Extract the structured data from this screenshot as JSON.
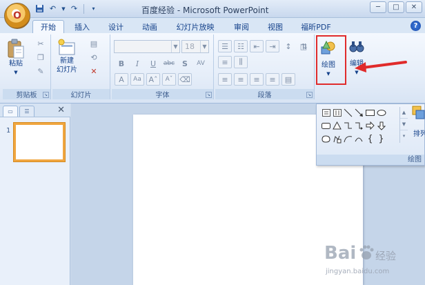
{
  "window": {
    "title": "百度经验 - Microsoft PowerPoint",
    "office_button_glyph": "O"
  },
  "quick_access": [
    "save-icon",
    "undo-icon",
    "redo-icon",
    "customize-icon"
  ],
  "window_buttons": {
    "minimize": "─",
    "restore": "□",
    "close": "✕"
  },
  "tabs": [
    {
      "label": "开始",
      "active": true
    },
    {
      "label": "插入"
    },
    {
      "label": "设计"
    },
    {
      "label": "动画"
    },
    {
      "label": "幻灯片放映"
    },
    {
      "label": "审阅"
    },
    {
      "label": "视图"
    },
    {
      "label": "福昕PDF"
    }
  ],
  "help_glyph": "?",
  "ribbon": {
    "clipboard": {
      "label": "剪贴板",
      "paste": "粘贴"
    },
    "slides": {
      "label": "幻灯片",
      "new_slide_line1": "新建",
      "new_slide_line2": "幻灯片"
    },
    "font": {
      "label": "字体",
      "font_name": "",
      "font_size": "18"
    },
    "paragraph": {
      "label": "段落"
    },
    "drawing": {
      "label": "绘图"
    },
    "editing": {
      "label": "编辑"
    }
  },
  "gallery": {
    "label": "绘图",
    "arrange": "排列"
  },
  "panel": {
    "slide_number": "1",
    "close_glyph": "✕"
  },
  "watermark": {
    "brand": "Bai",
    "cn": "经验",
    "url": "jingyan.baidu.com"
  },
  "colors": {
    "highlight": "#e02b2b",
    "accent": "#15428b",
    "selected_slide": "#f0a640"
  }
}
